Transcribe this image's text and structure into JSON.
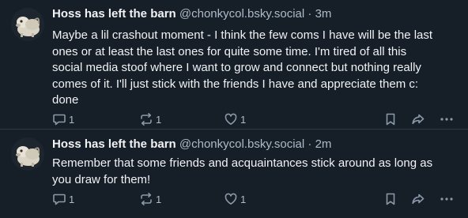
{
  "posts": [
    {
      "author_name": "Hoss has left the barn",
      "handle": "@chonkycol.bsky.social",
      "separator": "·",
      "time": "3m",
      "text_lines": [
        "Maybe a lil crashout moment - I think the few coms I have will be the last",
        "ones or at least the last ones for quite some time. I'm tired of all this",
        "social media stoof where I want to grow and connect but nothing really",
        "comes of it. I'll just stick with the friends I have and appreciate them c:",
        "done"
      ],
      "replies": "1",
      "reposts": "1",
      "likes": "1",
      "icons": [
        "avatar-icon",
        "reply-icon",
        "repost-icon",
        "like-icon",
        "bookmark-icon",
        "share-icon",
        "more-icon"
      ]
    },
    {
      "author_name": "Hoss has left the barn",
      "handle": "@chonkycol.bsky.social",
      "separator": "·",
      "time": "2m",
      "text_lines": [
        "Remember that some friends and acquaintances stick around as long as",
        "you draw for them!"
      ],
      "replies": "1",
      "reposts": "1",
      "likes": "1",
      "icons": [
        "avatar-icon",
        "reply-icon",
        "repost-icon",
        "like-icon",
        "bookmark-icon",
        "share-icon",
        "more-icon"
      ]
    }
  ],
  "colors": {
    "background": "#161e27",
    "text": "#f1f3f5",
    "muted": "#aebbc9",
    "icon": "#8a98a8",
    "divider": "#2e3a48"
  }
}
